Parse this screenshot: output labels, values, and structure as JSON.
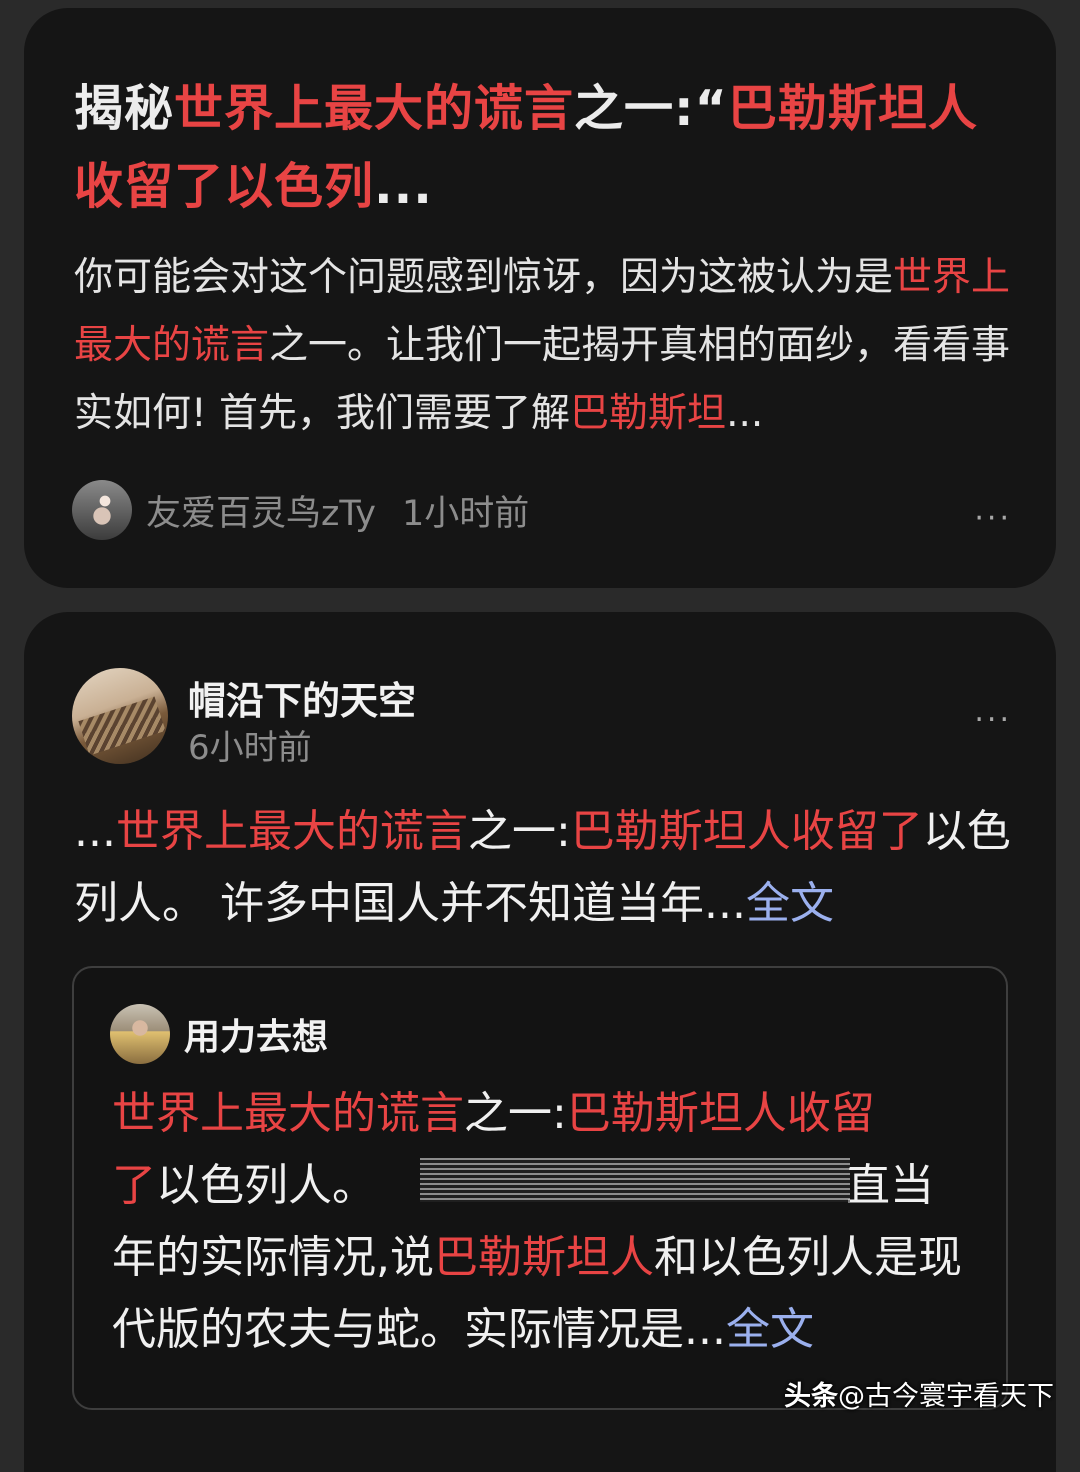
{
  "card1": {
    "title_parts": [
      "揭秘",
      "世界上最大的谎言",
      "之一:“",
      "巴勒斯坦人收留了以色列",
      "..."
    ],
    "summary_parts": [
      "你可能会对这个问题感到惊讶，因为这被认为是",
      "世界上最大的谎言",
      "之一。让我们一起揭开真相的面纱，看看事实如何! 首先，我们需要了解",
      "巴勒斯坦",
      "..."
    ],
    "author": "友爱百灵鸟zTy",
    "time": "1小时前",
    "more_icon": "..."
  },
  "card2": {
    "author": "帽沿下的天空",
    "time": "6小时前",
    "more_icon": "...",
    "body_parts": [
      "...",
      "世界上最大的谎言",
      "之一:",
      "巴勒斯坦人收留了",
      "以色列人。 许多中国人并不知道当年...",
      "全文"
    ],
    "quote": {
      "author": "用力去想",
      "text_parts": [
        "世界上最大的谎言",
        "之一:",
        "巴勒斯坦人收留",
        "了",
        "以色列人。",
        "",
        "直当年的实际情况,说",
        "巴勒斯坦人",
        "和以色列人是现代版的农夫与蛇。实际情况是...",
        "全文"
      ]
    }
  },
  "watermark": {
    "brand": "头条",
    "handle": "@古今寰宇看天下"
  },
  "colors": {
    "background": "#2a2a2a",
    "card": "#151515",
    "highlight": "#e84444",
    "link": "#9bb0ee",
    "meta": "#8c8c8c"
  }
}
